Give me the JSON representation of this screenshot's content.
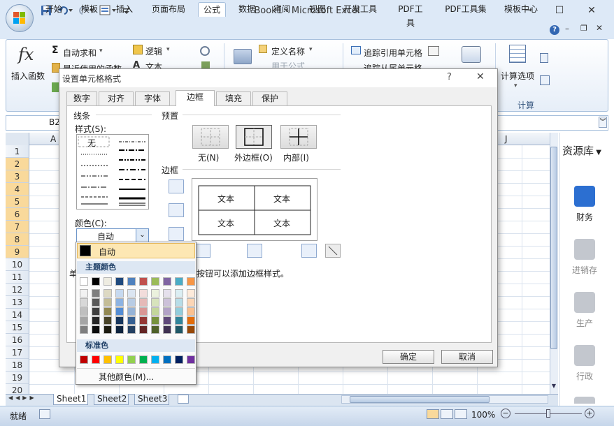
{
  "window": {
    "title": "Book1 - Microsoft Excel",
    "min": "─",
    "max": "☐",
    "close": "✕"
  },
  "ribbon": {
    "tabs": [
      "开始",
      "模板",
      "插入",
      "页面布局",
      "公式",
      "数据",
      "审阅",
      "视图",
      "开发工具",
      "PDF工具",
      "PDF工具集",
      "模板中心"
    ],
    "active_tab": "公式",
    "insert_function": "插入函数",
    "fx": "fx",
    "autosum": "自动求和",
    "recent": "最近使用的函数",
    "logic": "逻辑",
    "text": "文本",
    "define_name": "定义名称",
    "use_in_formula": "用于公式",
    "trace_precedents": "追踪引用单元格",
    "trace_dependents": "追踪从属单元格",
    "calc_options": "计算选项",
    "calc_group": "计算"
  },
  "namebox": {
    "value": "B2"
  },
  "grid": {
    "columns": [
      "A",
      "J"
    ],
    "rows": [
      "1",
      "2",
      "3",
      "4",
      "5",
      "6",
      "7",
      "8",
      "9",
      "10",
      "11",
      "12",
      "13",
      "14",
      "15",
      "16",
      "17",
      "18",
      "19",
      "20"
    ],
    "selected_rows": [
      "2",
      "3",
      "4",
      "5",
      "6",
      "7",
      "8",
      "9"
    ]
  },
  "sheets": [
    "Sheet1",
    "Sheet2",
    "Sheet3"
  ],
  "status": {
    "ready": "就绪",
    "zoom": "100%"
  },
  "right_panel": {
    "title": "资源库",
    "items": [
      {
        "label": "财务",
        "icon": "wallet-icon",
        "color": "#2c6fd1"
      },
      {
        "label": "进销存",
        "icon": "exchange-icon",
        "color": "#b8bcc4"
      },
      {
        "label": "生产",
        "icon": "production-icon",
        "color": "#b8bcc4"
      },
      {
        "label": "行政",
        "icon": "building-icon",
        "color": "#b8bcc4"
      }
    ]
  },
  "dialog": {
    "title": "设置单元格格式",
    "help": "?",
    "close": "✕",
    "tabs": [
      "数字",
      "对齐",
      "字体",
      "边框",
      "填充",
      "保护"
    ],
    "active_tab": "边框",
    "line_group": "线条",
    "style_label": "样式(S):",
    "none_style": "无",
    "color_label": "颜色(C):",
    "color_value": "自动",
    "preset_group": "预置",
    "presets": [
      "无(N)",
      "外边框(O)",
      "内部(I)"
    ],
    "border_group": "边框",
    "preview_text": [
      "文本",
      "文本",
      "文本",
      "文本"
    ],
    "hint_prefix": "单",
    "hint": "按钮可以添加边框样式。",
    "ok": "确定",
    "cancel": "取消"
  },
  "colorpicker": {
    "auto": "自动",
    "theme_header": "主题颜色",
    "standard_header": "标准色",
    "more": "其他颜色(M)...",
    "theme_top": [
      "#ffffff",
      "#000000",
      "#eeece1",
      "#1f497d",
      "#4f81bd",
      "#c0504d",
      "#9bbb59",
      "#8064a2",
      "#4bacc6",
      "#f79646"
    ],
    "theme_shades": [
      [
        "#f2f2f2",
        "#7f7f7f",
        "#ddd9c3",
        "#c6d9f0",
        "#dbe5f1",
        "#f2dcdb",
        "#ebf1dd",
        "#e5e0ec",
        "#dbeef3",
        "#fdeada"
      ],
      [
        "#d8d8d8",
        "#595959",
        "#c4bd97",
        "#8db3e2",
        "#b8cce4",
        "#e5b9b7",
        "#d7e3bc",
        "#ccc1d9",
        "#b7dde8",
        "#fbd5b5"
      ],
      [
        "#bfbfbf",
        "#3f3f3f",
        "#938953",
        "#548dd4",
        "#95b3d7",
        "#d99694",
        "#c3d69b",
        "#b2a2c7",
        "#92cddc",
        "#fac08f"
      ],
      [
        "#a5a5a5",
        "#262626",
        "#494429",
        "#17365d",
        "#366092",
        "#953734",
        "#76923c",
        "#5f497a",
        "#31859b",
        "#e36c09"
      ],
      [
        "#7f7f7f",
        "#0c0c0c",
        "#1d1b10",
        "#0f243e",
        "#244061",
        "#632423",
        "#4f6128",
        "#3f3151",
        "#205867",
        "#974806"
      ]
    ],
    "standard": [
      "#c00000",
      "#ff0000",
      "#ffc000",
      "#ffff00",
      "#92d050",
      "#00b050",
      "#00b0f0",
      "#0070c0",
      "#002060",
      "#7030a0"
    ]
  }
}
